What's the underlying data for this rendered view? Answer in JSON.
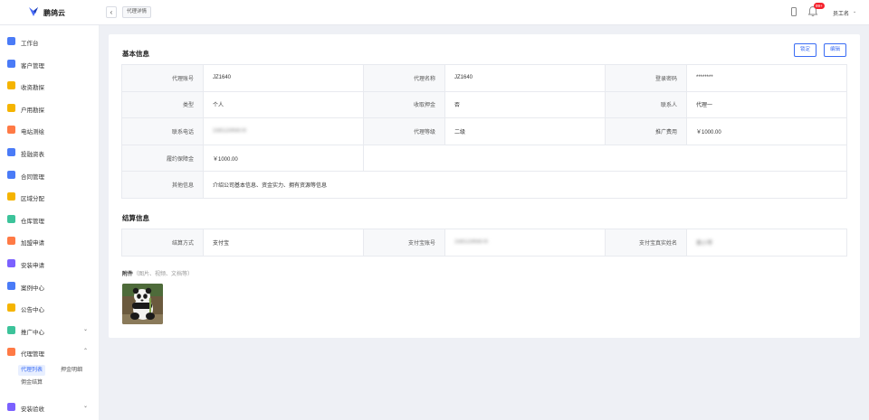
{
  "app": {
    "brand": "鹏鸽云"
  },
  "topbar": {
    "back_symbol": "‹",
    "tab_label": "代理详情",
    "notification_badge": "99+",
    "user_name": "员工名",
    "user_caret": "⌄"
  },
  "sidebar": {
    "items": [
      {
        "label": "工作台",
        "icon": "home-icon",
        "color": "#4a7bf7"
      },
      {
        "label": "客户管理",
        "icon": "customers-icon",
        "color": "#4a7bf7"
      },
      {
        "label": "收资勘探",
        "icon": "folder-icon",
        "color": "#f5b400"
      },
      {
        "label": "户用勘探",
        "icon": "folder-icon",
        "color": "#f5b400"
      },
      {
        "label": "电站测绘",
        "icon": "station-icon",
        "color": "#ff7a45"
      },
      {
        "label": "投融资表",
        "icon": "finance-icon",
        "color": "#4a7bf7"
      },
      {
        "label": "合同管理",
        "icon": "contract-icon",
        "color": "#4a7bf7"
      },
      {
        "label": "区域分配",
        "icon": "region-icon",
        "color": "#f5b400"
      },
      {
        "label": "仓库管理",
        "icon": "warehouse-icon",
        "color": "#3cc39a"
      },
      {
        "label": "加盟申请",
        "icon": "join-icon",
        "color": "#ff7a45"
      },
      {
        "label": "安装申请",
        "icon": "install-icon",
        "color": "#7b61ff"
      },
      {
        "label": "案例中心",
        "icon": "case-icon",
        "color": "#4a7bf7"
      },
      {
        "label": "公告中心",
        "icon": "bell-icon",
        "color": "#f5b400"
      },
      {
        "label": "推广中心",
        "icon": "send-icon",
        "color": "#3cc39a",
        "caret": "⌄"
      },
      {
        "label": "代理管理",
        "icon": "agent-icon",
        "color": "#ff7a45",
        "caret": "⌃"
      },
      {
        "label": "安装验收",
        "icon": "accept-icon",
        "color": "#7b61ff",
        "caret": "⌄"
      }
    ],
    "sub_items": [
      {
        "label": "代理列表",
        "active": true
      },
      {
        "label": "押金明细",
        "active": false
      },
      {
        "label": "佣金结算",
        "active": false
      }
    ]
  },
  "main": {
    "basic_title": "基本信息",
    "buttons": {
      "lock": "锁定",
      "edit": "编辑"
    },
    "basic_rows": [
      [
        {
          "label": "代理账号",
          "value": "JZ1640"
        },
        {
          "label": "代理名称",
          "value": "JZ1640"
        },
        {
          "label": "登录密码",
          "value": "********"
        }
      ],
      [
        {
          "label": "类型",
          "value": "个人"
        },
        {
          "label": "收取押金",
          "value": "否"
        },
        {
          "label": "联系人",
          "value": "代理一"
        }
      ],
      [
        {
          "label": "联系电话",
          "value": "15812345678",
          "blur": true
        },
        {
          "label": "代理等级",
          "value": "二级"
        },
        {
          "label": "推广费用",
          "value": "￥1000.00"
        }
      ],
      [
        {
          "label": "履约保障金",
          "value": "￥1000.00"
        }
      ]
    ],
    "other_label": "其他信息",
    "other_value": "介绍公司基本信息、资金实力、拥有资源等信息",
    "settle_title": "结算信息",
    "settle_rows": [
      [
        {
          "label": "结算方式",
          "value": "支付宝"
        },
        {
          "label": "支付宝账号",
          "value": "15812345678",
          "blur": true
        },
        {
          "label": "支付宝真实姓名",
          "value": "黄小琴",
          "blur": true
        }
      ]
    ],
    "attachment_label": "附件",
    "attachment_hint": "（图片、视频、文档等）"
  }
}
